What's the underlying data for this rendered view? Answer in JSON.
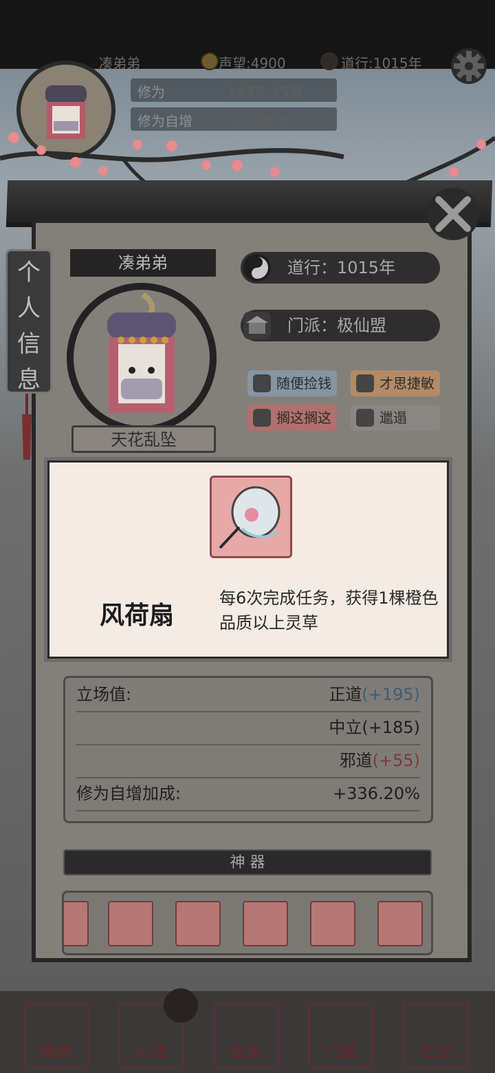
{
  "hud": {
    "player_name": "凑弟弟",
    "reputation": "声望:4900",
    "daoxing": "道行:1015年",
    "cultivation_label": "修为",
    "cultivation_value": "1416.45兆",
    "growth_label": "修为自增",
    "growth_value": "4.48兆/年"
  },
  "side_tab": {
    "label": [
      "个",
      "人",
      "信",
      "息"
    ]
  },
  "profile": {
    "name": "凑弟弟",
    "title": "天花乱坠",
    "daoxing": "道行：1015年",
    "sect": "门派：极仙盟",
    "traits": [
      "随便捡钱",
      "才思捷敏",
      "搁这搁这",
      "邋遢"
    ]
  },
  "popup": {
    "item_name": "风荷扇",
    "description": "每6次完成任务，获得1棵橙色品质以上灵草"
  },
  "stats": {
    "stance_label": "立场值:",
    "rows": [
      {
        "name": "正道",
        "value": "(+195)"
      },
      {
        "name": "中立(+185)",
        "value": ""
      },
      {
        "name": "邪道",
        "value": "(+55)"
      }
    ],
    "growth_bonus_label": "修为自增加成:",
    "growth_bonus_value": "+336.20%"
  },
  "artifacts_title": "神 器",
  "nav": [
    "修炼",
    "心法",
    "任务",
    "门派",
    "社交"
  ],
  "colors": {
    "positive": "#3e5d72",
    "negative": "#7b3b3b"
  }
}
